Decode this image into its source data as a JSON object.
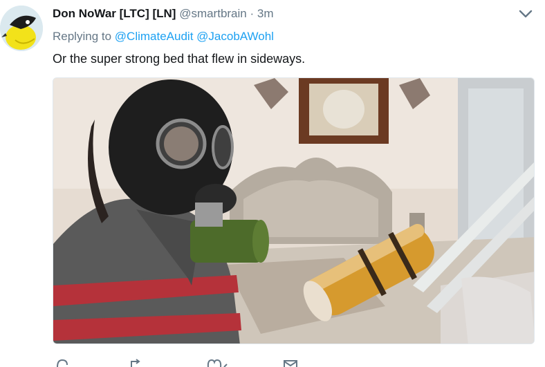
{
  "tweet": {
    "author_name": "Don NoWar [LTC] [LN]",
    "author_handle": "@smartbrain",
    "separator": "·",
    "time": "3m",
    "replying_label": "Replying to",
    "mention_1": "@ClimateAudit",
    "mention_2": "@JacobAWohl",
    "text": "Or the super strong bed that flew in sideways."
  },
  "icons": {
    "avatar": "bird-avatar",
    "menu": "chevron-down-icon",
    "reply": "reply-icon",
    "retweet": "retweet-icon",
    "like": "heart-icon",
    "dm": "envelope-icon"
  },
  "colors": {
    "link": "#1da1f2",
    "secondary_text": "#657786",
    "primary_text": "#14171a"
  }
}
